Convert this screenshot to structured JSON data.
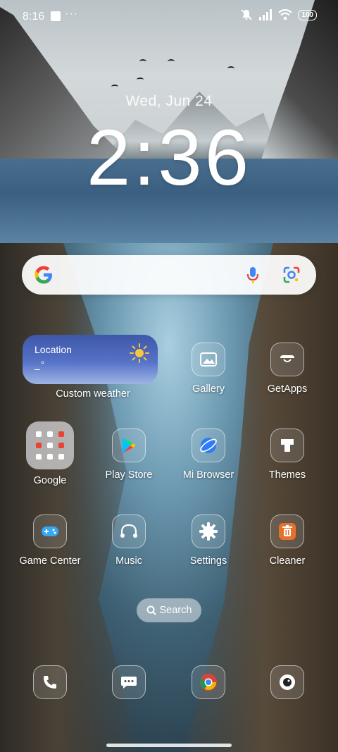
{
  "status_bar": {
    "time": "8:16",
    "dots": "···",
    "battery": "100"
  },
  "lockscreen": {
    "date": "Wed, Jun 24",
    "time": "2:36"
  },
  "search_bar": {
    "icons": [
      "google-logo",
      "mic-icon",
      "lens-icon"
    ]
  },
  "weather_widget": {
    "location": "Location",
    "temp": "_°",
    "label": "Custom weather"
  },
  "apps": {
    "gallery": "Gallery",
    "getapps": "GetApps",
    "google": "Google",
    "play_store": "Play Store",
    "mi_browser": "Mi Browser",
    "themes": "Themes",
    "game_center": "Game Center",
    "music": "Music",
    "settings": "Settings",
    "cleaner": "Cleaner"
  },
  "search_pill": {
    "label": "Search"
  },
  "dock": [
    "phone-icon",
    "messages-icon",
    "chrome-icon",
    "camera-icon"
  ],
  "colors": {
    "weather_top": "#3f57a8",
    "weather_bottom": "#9fb4e4",
    "cleaner_orange": "#e8712a"
  }
}
